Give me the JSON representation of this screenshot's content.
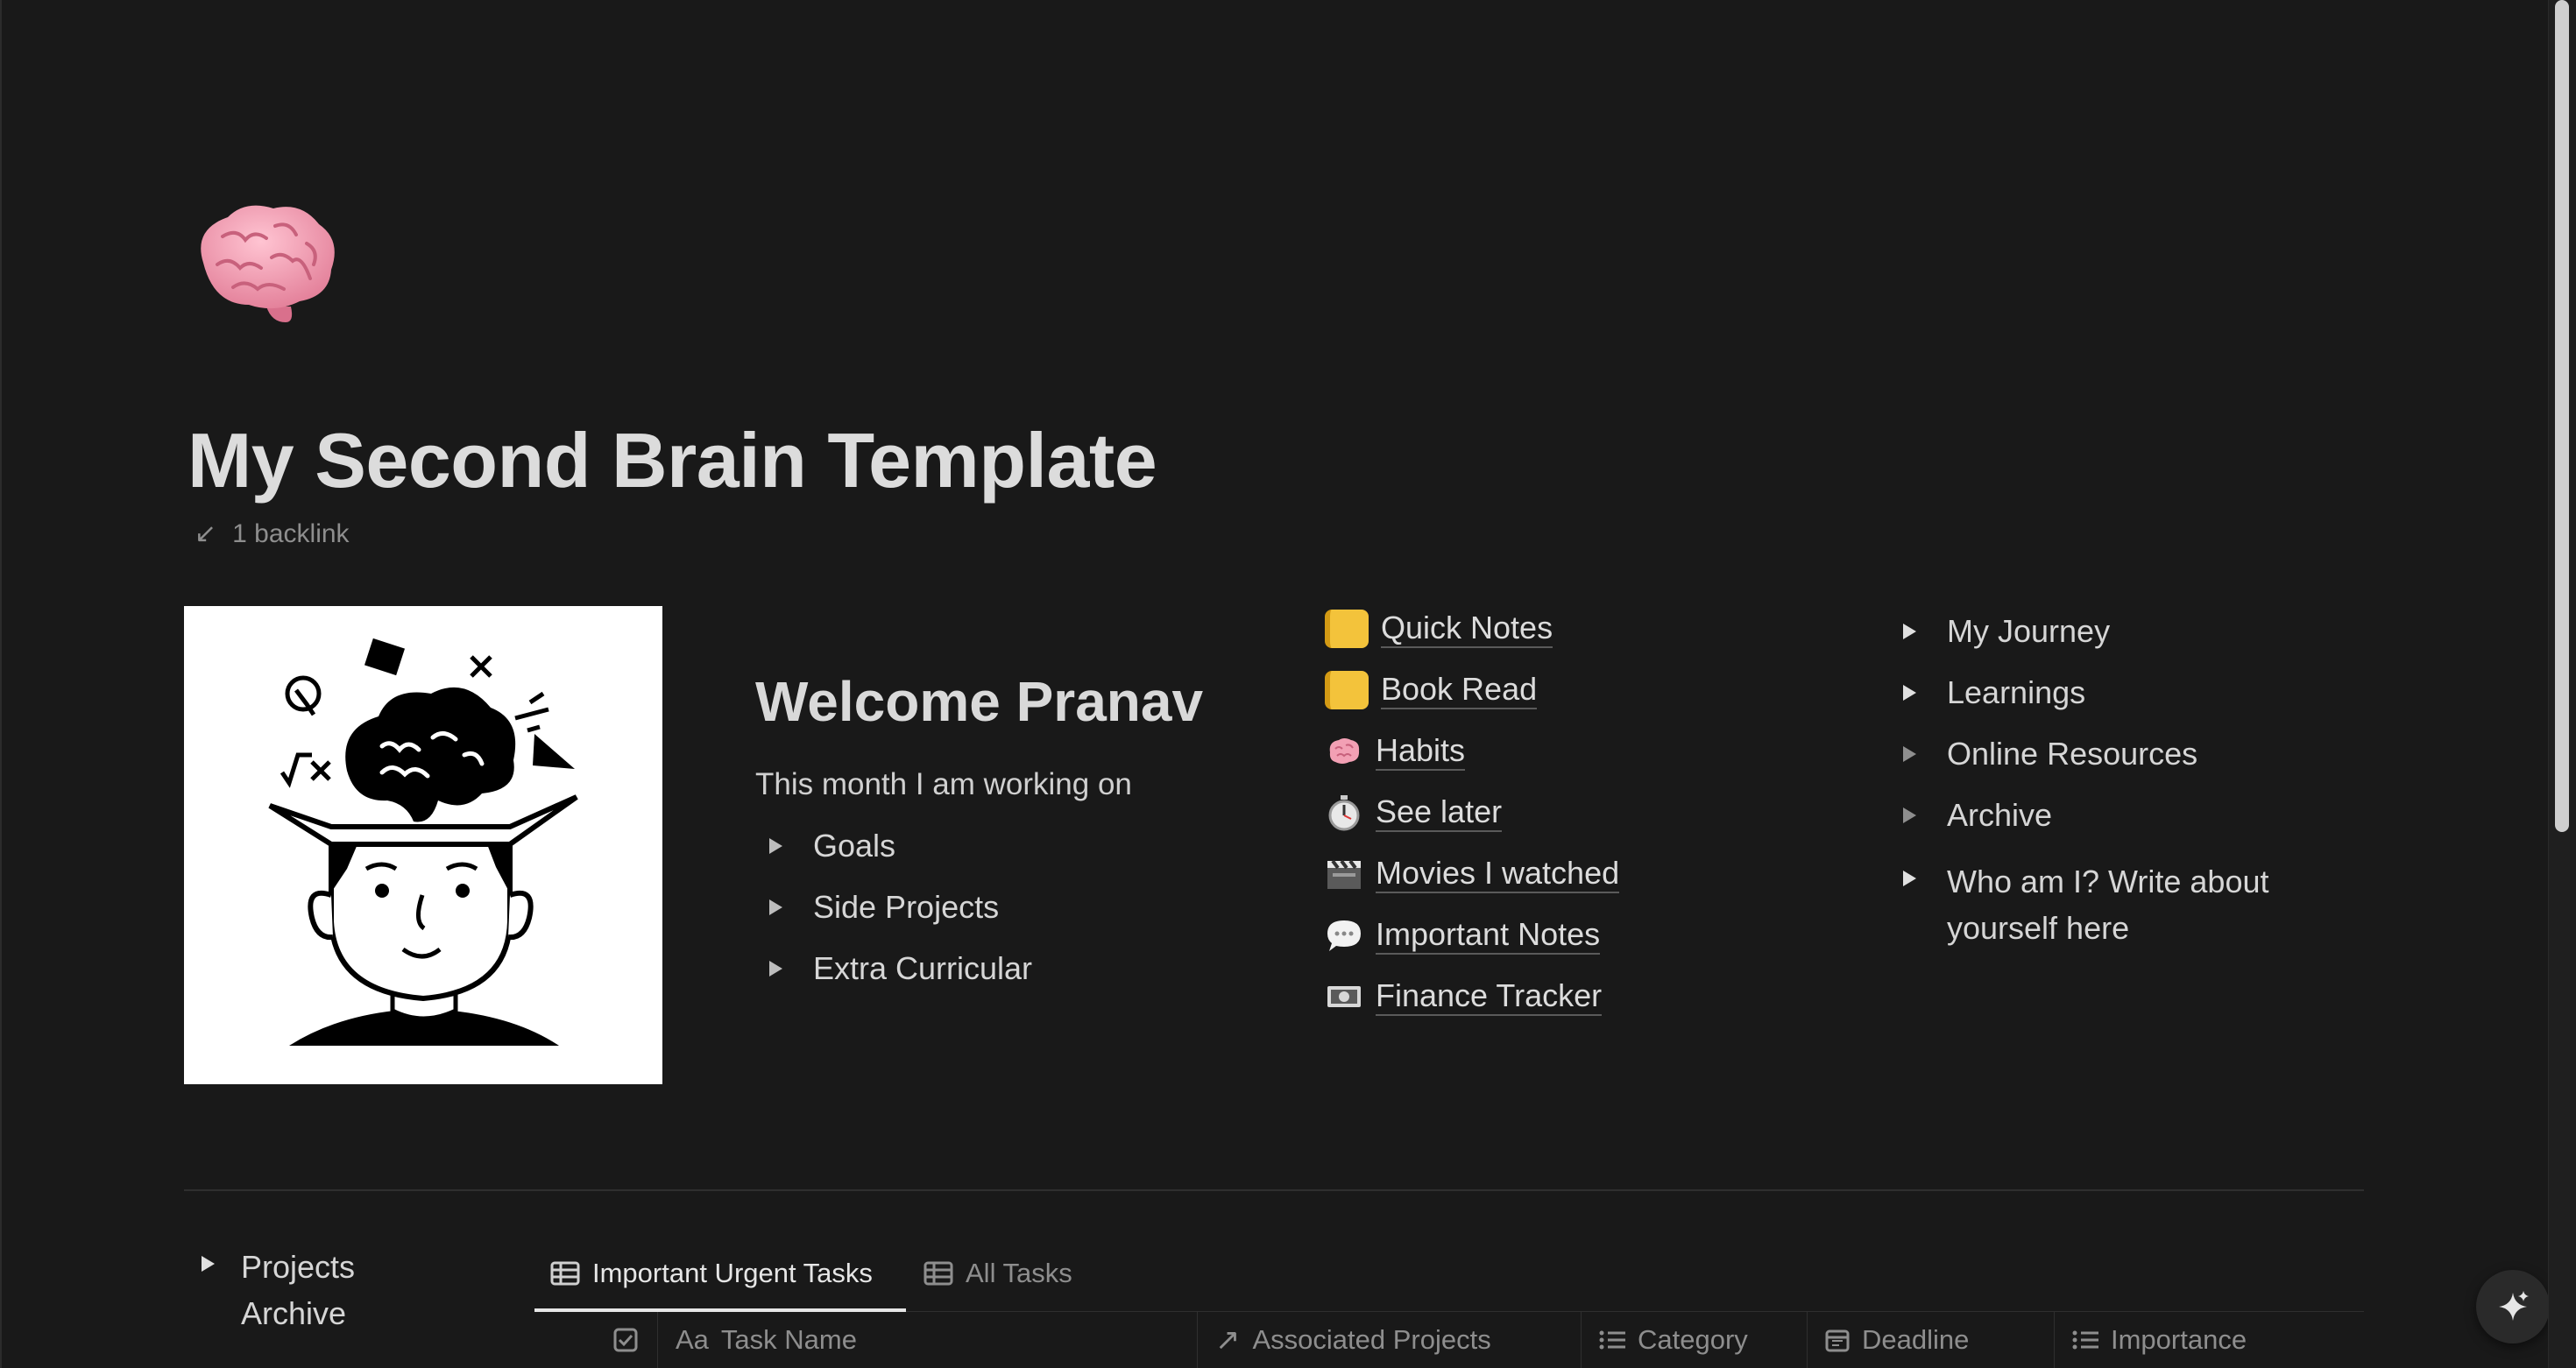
{
  "page": {
    "title": "My Second Brain Template",
    "backlink": "1 backlink",
    "icon": "brain-emoji"
  },
  "welcome": {
    "heading": "Welcome Pranav",
    "subtitle": "This month I am working on",
    "toggles": [
      "Goals",
      "Side Projects",
      "Extra Curricular"
    ]
  },
  "links": [
    {
      "icon": "notepad-icon",
      "label": "Quick Notes"
    },
    {
      "icon": "notepad-icon",
      "label": "Book Read"
    },
    {
      "icon": "brain-icon",
      "label": "Habits"
    },
    {
      "icon": "stopwatch-icon",
      "label": "See later"
    },
    {
      "icon": "clapperboard-icon",
      "label": "Movies I watched"
    },
    {
      "icon": "speech-bubble-icon",
      "label": "Important Notes"
    },
    {
      "icon": "money-icon",
      "label": "Finance Tracker"
    }
  ],
  "right_toggles": [
    "My Journey",
    "Learnings",
    "Online Resources",
    "Archive",
    "Who am I? Write about yourself here"
  ],
  "bottom": {
    "projects_archive": "Projects Archive",
    "tabs": [
      "Important Urgent Tasks",
      "All Tasks"
    ],
    "columns": [
      "Task Name",
      "Associated Projects",
      "Category",
      "Deadline",
      "Importance"
    ],
    "task_name_prefix": "Aa"
  }
}
